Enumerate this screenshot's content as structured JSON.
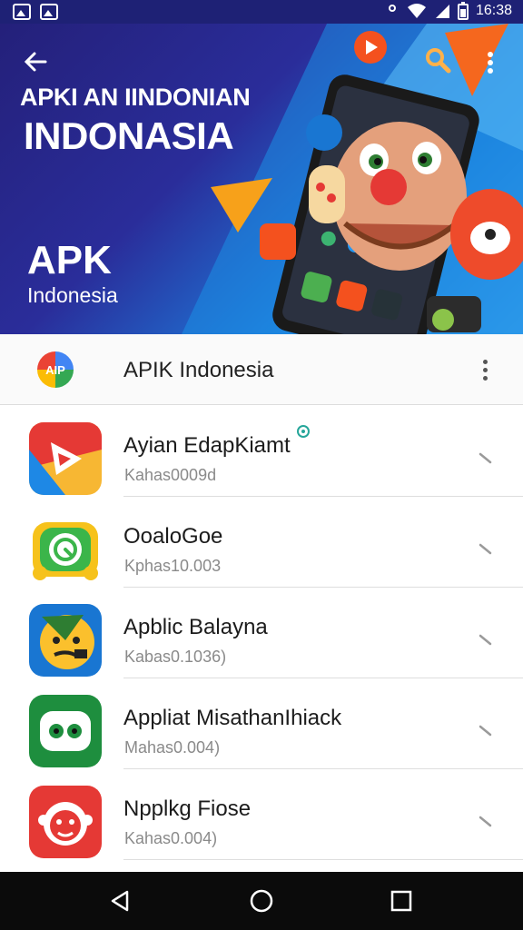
{
  "status_bar": {
    "time": "16:38"
  },
  "hero": {
    "title_line1": "APKI AN IINDONIAN",
    "title_line2": "INDONASIA",
    "brand": "APK",
    "subtitle": "Indonesia"
  },
  "app_header": {
    "title": "APIK Indonesia",
    "logo_text": "AIP"
  },
  "apps": [
    {
      "name": "Ayian EdapKiamt",
      "meta": "Kahas0009d",
      "icon": "play-triangle-icon",
      "color": "#f2994a"
    },
    {
      "name": "OoaloGoe",
      "meta": "Kphas10.003",
      "icon": "alarm-clock-icon",
      "color": "#f5c518"
    },
    {
      "name": "Apblic Balayna",
      "meta": "Kabas0.1036)",
      "icon": "emoji-face-icon",
      "color": "#1976d2"
    },
    {
      "name": "Appliat MisathanIhiack",
      "meta": "Mahas0.004)",
      "icon": "eyes-chat-icon",
      "color": "#1e8e3e"
    },
    {
      "name": "Npplkg Fiose",
      "meta": "Kahas0.004)",
      "icon": "monkey-face-icon",
      "color": "#e53935"
    }
  ]
}
